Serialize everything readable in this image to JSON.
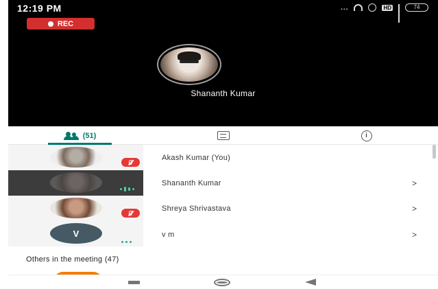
{
  "status_bar": {
    "time": "12:19 PM",
    "dots": "...",
    "hd_badge": "HD",
    "battery": "74"
  },
  "recording": {
    "label": "REC"
  },
  "active_speaker": {
    "name": "Shananth Kumar"
  },
  "tabs": [
    {
      "name": "people",
      "label": "(51)",
      "icon": "people-icon",
      "active": true
    },
    {
      "name": "chat",
      "icon": "chat-icon",
      "active": false
    },
    {
      "name": "info",
      "icon": "info-icon",
      "active": false
    }
  ],
  "participants": [
    {
      "name": "Akash Kumar (You)",
      "avatar": "photo",
      "status": "muted",
      "chevron": ""
    },
    {
      "name": "Shananth Kumar",
      "avatar": "photo",
      "status": "speaking",
      "chevron": ">"
    },
    {
      "name": "Shreya Shrivastava",
      "avatar": "photo",
      "status": "muted",
      "chevron": ">"
    },
    {
      "name": "v m",
      "avatar": "V",
      "status": "idle",
      "chevron": ">"
    }
  ],
  "others_heading": "Others in the meeting (47)",
  "colors": {
    "accent": "#00796b",
    "rec": "#d32f2f",
    "muted_badge": "#e53935",
    "speaking": "#4dd0a1",
    "avatar_v": "#455a64"
  }
}
